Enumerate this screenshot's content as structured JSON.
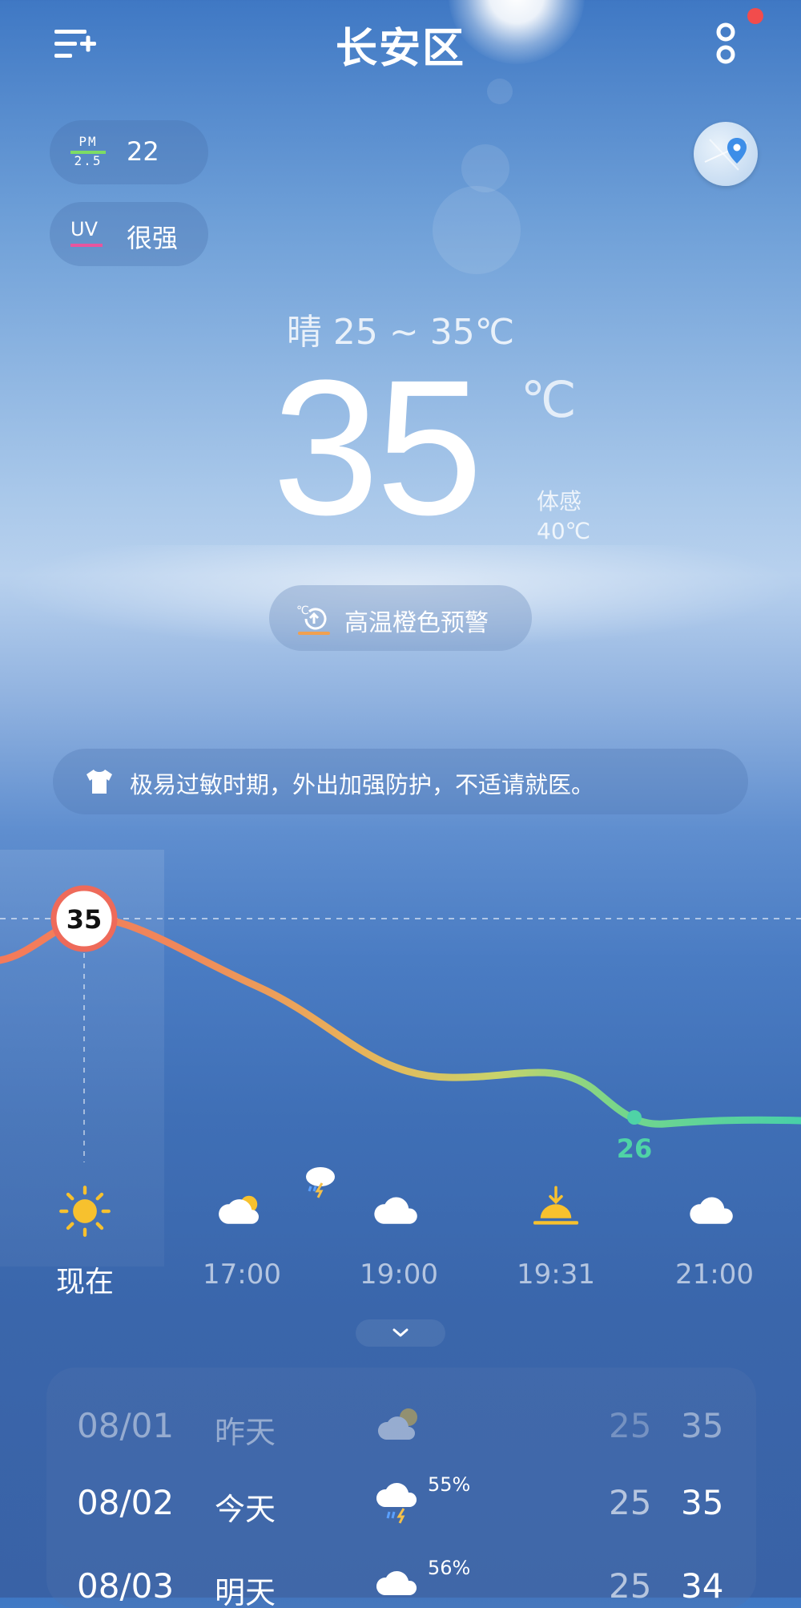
{
  "header": {
    "city": "长安区"
  },
  "air": {
    "pm_label_top": "PM",
    "pm_label_bottom": "2.5",
    "pm_value": "22",
    "uv_label": "UV",
    "uv_value": "很强"
  },
  "current": {
    "condition_line": "晴  25 ~ 35℃",
    "temperature": "35",
    "unit": "℃",
    "feels_label": "体感",
    "feels_value": "40℃",
    "warning": "高温橙色预警"
  },
  "tip": "极易过敏时期，外出加强防护，不适请就医。",
  "hourly": {
    "current_marker": "35",
    "low_marker": "26",
    "items": [
      {
        "label": "现在",
        "icon": "sun-icon"
      },
      {
        "label": "17:00",
        "icon": "partly-cloudy-icon"
      },
      {
        "label": "19:00",
        "icon": "cloud-icon"
      },
      {
        "label": "19:31",
        "icon": "sunset-icon"
      },
      {
        "label": "21:00",
        "icon": "cloud-icon"
      }
    ],
    "extra_icon": "thunder-rain-icon"
  },
  "daily": [
    {
      "date": "08/01",
      "day": "昨天",
      "icon": "partly-cloudy-icon",
      "precip": "",
      "low": "25",
      "high": "35"
    },
    {
      "date": "08/02",
      "day": "今天",
      "icon": "thunder-rain-icon",
      "precip": "55%",
      "low": "25",
      "high": "35"
    },
    {
      "date": "08/03",
      "day": "明天",
      "icon": "cloud-icon",
      "precip": "56%",
      "low": "25",
      "high": "34"
    }
  ],
  "colors": {
    "background_top": "#3f78c4",
    "curve_warm": "#f07a5e",
    "curve_cool": "#4fd3a6",
    "warning_accent": "#f0a050",
    "alert_dot": "#f24c4c"
  }
}
